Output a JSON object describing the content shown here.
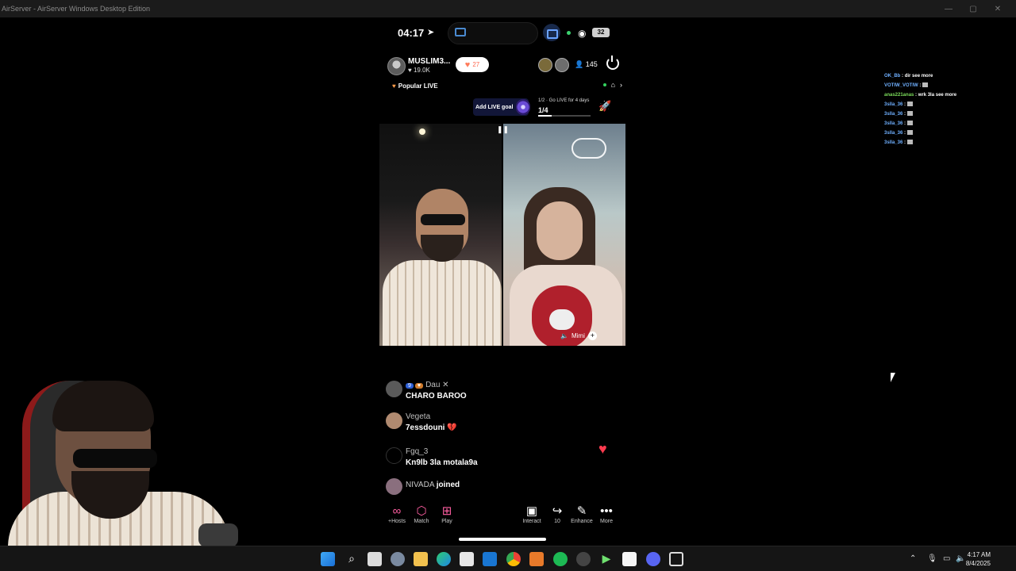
{
  "window": {
    "title": "AirServer - AirServer Windows Desktop Edition",
    "minimize": "—",
    "maximize": "▢",
    "close": "✕"
  },
  "status_bar": {
    "time": "04:17",
    "battery": "32"
  },
  "live": {
    "host_name": "MUSLIM3...",
    "host_likes": "19.0K",
    "follow_count": "27",
    "viewer_count": "145",
    "popular": "Popular LIVE",
    "goal_label": "Add LIVE goal",
    "goal_task_top": "1/2 · Go LIVE for 4 days",
    "goal_task_progress": "1/4",
    "goal_task_fraction": 0.25,
    "guest_name": "Mimi"
  },
  "chat": {
    "messages": [
      {
        "name": "Dau ✕",
        "badge": "9",
        "text": "CHARO BAROO"
      },
      {
        "name": "Vegeta",
        "text": "7essdouni 💔"
      },
      {
        "name": "Fgq_3",
        "text": "Kn9lb 3la motala9a"
      }
    ],
    "joined_user": "NIVADA",
    "joined_word": "joined"
  },
  "actions": {
    "hosts": "+Hosts",
    "match": "Match",
    "play": "Play",
    "interact": "Interact",
    "share": "10",
    "enhance": "Enhance",
    "more": "More"
  },
  "side_chat": [
    {
      "user": "OK_Bb",
      "text": "dir see more"
    },
    {
      "user": "VOTIW_VOTIW",
      "text": ""
    },
    {
      "user": "anas221anas",
      "text": "wrk 3la see more"
    },
    {
      "user": "3slla_36",
      "text": ""
    },
    {
      "user": "3slla_36",
      "text": ""
    },
    {
      "user": "3slla_36",
      "text": ""
    },
    {
      "user": "3slla_36",
      "text": ""
    },
    {
      "user": "3slla_36",
      "text": ""
    }
  ],
  "taskbar": {
    "time": "4:17 AM",
    "date": "8/4/2025"
  },
  "colors": {
    "accent_pink": "#ff5fa2",
    "heart_red": "#ff3b4f",
    "link_blue": "#6fb0ff"
  }
}
